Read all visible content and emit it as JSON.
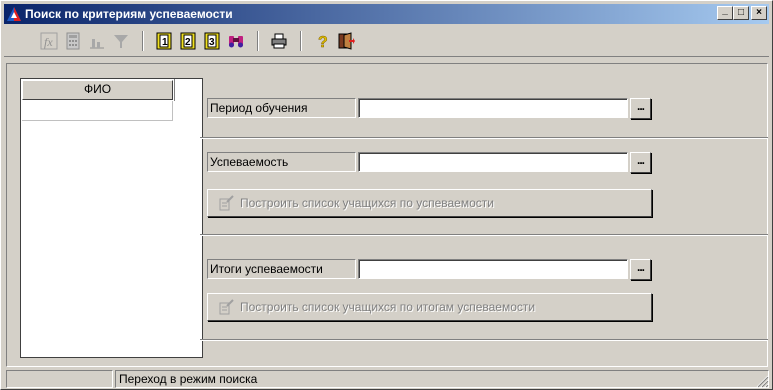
{
  "window": {
    "title": "Поиск по критериям успеваемости",
    "buttons": {
      "minimize": "_",
      "maximize": "□",
      "close": "×"
    }
  },
  "toolbar": {
    "icons": [
      "formula-icon",
      "calculator-icon",
      "bar-chart-icon",
      "filter-icon",
      "page-1-icon",
      "page-2-icon",
      "page-3-icon",
      "binoculars-icon",
      "printer-icon",
      "help-icon",
      "exit-icon"
    ],
    "page_labels": [
      "1",
      "2",
      "3"
    ],
    "help_glyph": "?"
  },
  "list": {
    "column_header": "ФИО"
  },
  "sections": {
    "period": {
      "label": "Период обучения",
      "value": "",
      "picker": "..."
    },
    "performance": {
      "label": "Успеваемость",
      "value": "",
      "picker": "...",
      "build_button": "Построить список учащихся по успеваемости"
    },
    "results": {
      "label": "Итоги успеваемости",
      "value": "",
      "picker": "...",
      "build_button": "Построить список учащихся по итогам успеваемости"
    }
  },
  "statusbar": {
    "cell1": "",
    "message": "Переход в режим поиска"
  },
  "colors": {
    "face": "#d4d0c8",
    "title_start": "#0a246a",
    "title_end": "#a6caf0",
    "disabled_text": "#808080"
  }
}
